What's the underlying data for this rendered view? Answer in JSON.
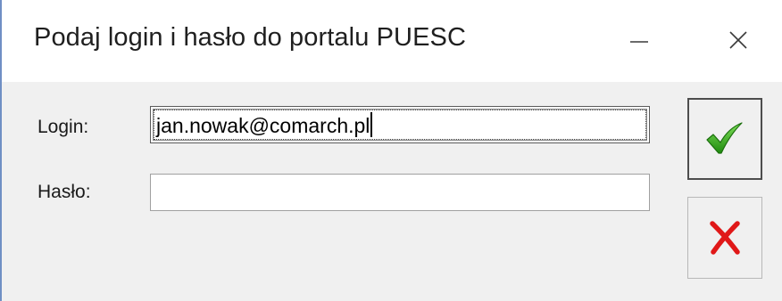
{
  "window": {
    "title": "Podaj login i hasło do portalu PUESC",
    "minimize_icon": "minimize-icon",
    "close_icon": "close-icon"
  },
  "form": {
    "login_label": "Login:",
    "login_value": "jan.nowak@comarch.pl",
    "password_label": "Hasło:",
    "password_value": ""
  },
  "buttons": {
    "ok_icon": "checkmark-icon",
    "cancel_icon": "cross-icon"
  },
  "colors": {
    "ok_green": "#2fa019",
    "cancel_red": "#e01818",
    "window_border": "#6f8fc4"
  }
}
